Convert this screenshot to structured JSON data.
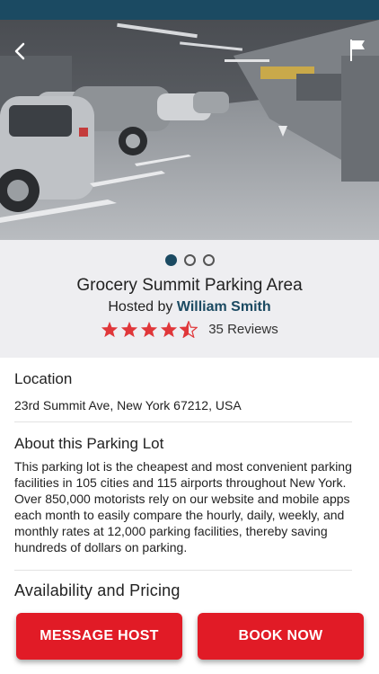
{
  "header": {
    "back_icon": "chevron-left-icon",
    "report_icon": "flag-icon"
  },
  "gallery": {
    "image": "parking-garage-photo",
    "page_count": 3,
    "active_index": 0
  },
  "listing": {
    "title": "Grocery Summit Parking Area",
    "hosted_prefix": "Hosted by",
    "host_name": "William Smith",
    "rating": 4.5,
    "reviews_label": "35 Reviews"
  },
  "location": {
    "heading": "Location",
    "address": "23rd Summit Ave, New York 67212, USA"
  },
  "about": {
    "heading": "About this Parking Lot",
    "text": "This parking lot is the cheapest and most convenient parking facilities in 105 cities and 115 airports throughout New York. Over 850,000 motorists rely on our website and mobile apps each month to easily compare the hourly, daily, weekly, and monthly rates at 12,000 parking facilities, thereby saving hundreds of dollars on parking."
  },
  "availability": {
    "heading": "Availability and Pricing"
  },
  "actions": {
    "message_label": "MESSAGE HOST",
    "book_label": "BOOK NOW"
  },
  "colors": {
    "brand": "#1b4a62",
    "accent": "#e11b26",
    "star": "#e0373a"
  }
}
